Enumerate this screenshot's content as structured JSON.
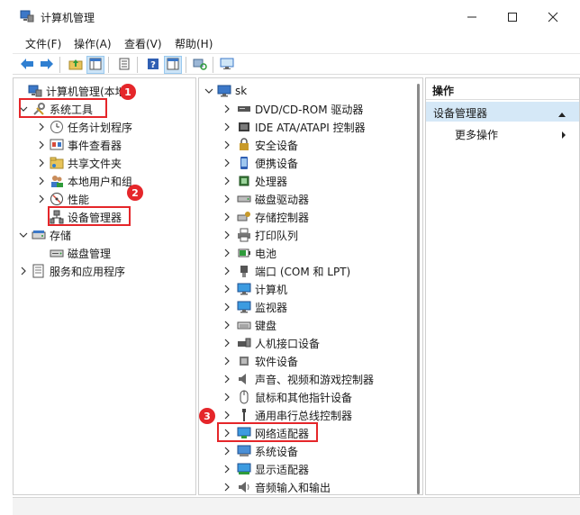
{
  "window": {
    "title": "计算机管理"
  },
  "menu": [
    {
      "label": "文件(F)"
    },
    {
      "label": "操作(A)"
    },
    {
      "label": "查看(V)"
    },
    {
      "label": "帮助(H)"
    }
  ],
  "left_tree": [
    {
      "label": "计算机管理(本地)",
      "icon": "computer-management-icon",
      "expander": "none"
    },
    {
      "label": "系统工具",
      "icon": "system-tools-icon",
      "expander": "expanded"
    },
    {
      "label": "任务计划程序",
      "icon": "clock-icon",
      "expander": "collapsed"
    },
    {
      "label": "事件查看器",
      "icon": "event-viewer-icon",
      "expander": "collapsed"
    },
    {
      "label": "共享文件夹",
      "icon": "shared-folder-icon",
      "expander": "collapsed"
    },
    {
      "label": "本地用户和组",
      "icon": "users-icon",
      "expander": "collapsed"
    },
    {
      "label": "性能",
      "icon": "performance-icon",
      "expander": "collapsed"
    },
    {
      "label": "设备管理器",
      "icon": "device-manager-icon",
      "expander": "none"
    },
    {
      "label": "存储",
      "icon": "storage-icon",
      "expander": "expanded"
    },
    {
      "label": "磁盘管理",
      "icon": "disk-management-icon",
      "expander": "none"
    },
    {
      "label": "服务和应用程序",
      "icon": "services-icon",
      "expander": "collapsed"
    }
  ],
  "device_tree": {
    "root": "sk",
    "items": [
      {
        "label": "DVD/CD-ROM 驱动器",
        "icon": "dvd-drive-icon"
      },
      {
        "label": "IDE ATA/ATAPI 控制器",
        "icon": "ide-controller-icon"
      },
      {
        "label": "安全设备",
        "icon": "security-device-icon"
      },
      {
        "label": "便携设备",
        "icon": "portable-device-icon"
      },
      {
        "label": "处理器",
        "icon": "processor-icon"
      },
      {
        "label": "磁盘驱动器",
        "icon": "disk-drive-icon"
      },
      {
        "label": "存储控制器",
        "icon": "storage-controller-icon"
      },
      {
        "label": "打印队列",
        "icon": "printer-icon"
      },
      {
        "label": "电池",
        "icon": "battery-icon"
      },
      {
        "label": "端口 (COM 和 LPT)",
        "icon": "port-icon"
      },
      {
        "label": "计算机",
        "icon": "computer-icon"
      },
      {
        "label": "监视器",
        "icon": "monitor-icon"
      },
      {
        "label": "键盘",
        "icon": "keyboard-icon"
      },
      {
        "label": "人机接口设备",
        "icon": "hid-icon"
      },
      {
        "label": "软件设备",
        "icon": "software-device-icon"
      },
      {
        "label": "声音、视频和游戏控制器",
        "icon": "speaker-icon"
      },
      {
        "label": "鼠标和其他指针设备",
        "icon": "mouse-icon"
      },
      {
        "label": "通用串行总线控制器",
        "icon": "usb-icon"
      },
      {
        "label": "网络适配器",
        "icon": "network-adapter-icon"
      },
      {
        "label": "系统设备",
        "icon": "system-device-icon"
      },
      {
        "label": "显示适配器",
        "icon": "display-adapter-icon"
      },
      {
        "label": "音频输入和输出",
        "icon": "audio-io-icon"
      }
    ]
  },
  "actions": {
    "title": "操作",
    "section": "设备管理器",
    "more": "更多操作"
  },
  "badges": [
    "1",
    "2",
    "3"
  ],
  "colors": {
    "highlight": "#e5262a",
    "selection": "#d5e8f7"
  }
}
